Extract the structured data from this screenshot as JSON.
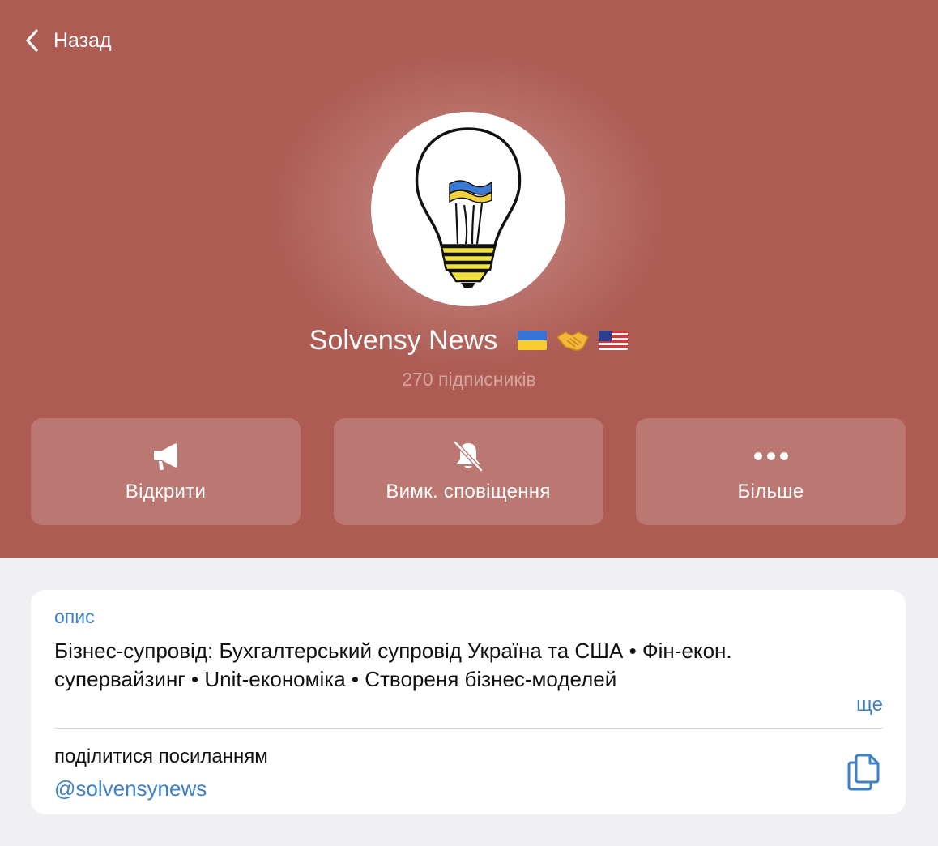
{
  "nav": {
    "back_label": "Назад"
  },
  "channel": {
    "name": "Solvensy News",
    "subscribers": "270 підписників",
    "avatar_icon": "lightbulb-ukraine-flag-icon",
    "title_emojis": [
      "ukraine-flag-icon",
      "handshake-icon",
      "us-flag-icon"
    ]
  },
  "actions": [
    {
      "label": "Відкрити",
      "icon": "megaphone-icon"
    },
    {
      "label": "Вимк. сповіщення",
      "icon": "bell-slash-icon"
    },
    {
      "label": "Більше",
      "icon": "ellipsis-icon"
    }
  ],
  "info": {
    "description_label": "опис",
    "description_line1": "Бізнес-супровід: Бухгалтерський супровід Україна та США • Фін-екон.",
    "description_line2": "супервайзинг • Unit-економіка • Створеня бізнес-моделей",
    "more_label": "ще",
    "share_label": "поділитися посиланням",
    "share_link": "@solvensynews",
    "copy_icon": "copy-icon"
  },
  "colors": {
    "header_bg": "#ad5b53",
    "accent": "#3d82c8",
    "page_bg": "#efeff4"
  }
}
